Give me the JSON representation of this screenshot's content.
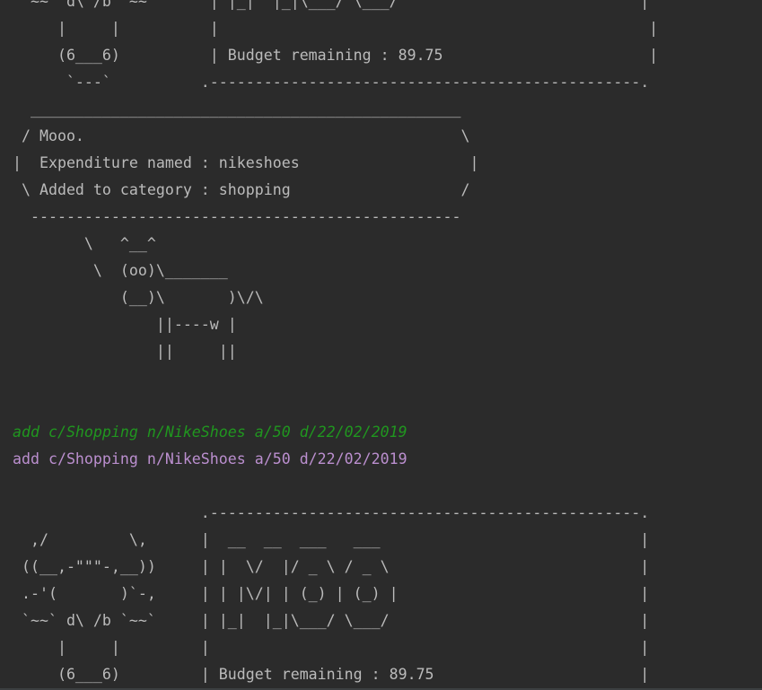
{
  "console": {
    "lines": [
      {
        "kind": "out",
        "text": " `~~` d\\ /b `~~`      | |_|  |_|\\___/ \\___/                           |"
      },
      {
        "kind": "out",
        "text": "     |     |          |                                                |"
      },
      {
        "kind": "out",
        "text": "     (6___6)          | Budget remaining : 89.75                       |"
      },
      {
        "kind": "out",
        "text": "      `---`          .------------------------------------------------."
      },
      {
        "kind": "out",
        "text": "  ________________________________________________"
      },
      {
        "kind": "out",
        "text": " / Mooo.                                          \\"
      },
      {
        "kind": "out",
        "text": "|  Expenditure named : nikeshoes                   |"
      },
      {
        "kind": "out",
        "text": " \\ Added to category : shopping                   /"
      },
      {
        "kind": "out",
        "text": "  ------------------------------------------------"
      },
      {
        "kind": "out",
        "text": "        \\   ^__^"
      },
      {
        "kind": "out",
        "text": "         \\  (oo)\\_______"
      },
      {
        "kind": "out",
        "text": "            (__)\\       )\\/\\"
      },
      {
        "kind": "out",
        "text": "                ||----w |"
      },
      {
        "kind": "out",
        "text": "                ||     ||"
      },
      {
        "kind": "out",
        "text": ""
      },
      {
        "kind": "out",
        "text": ""
      },
      {
        "kind": "echo",
        "text": "add c/Shopping n/NikeShoes a/50 d/22/02/2019"
      },
      {
        "kind": "exec",
        "text": "add c/Shopping n/NikeShoes a/50 d/22/02/2019"
      },
      {
        "kind": "out",
        "text": ""
      },
      {
        "kind": "out",
        "text": "                     .------------------------------------------------."
      },
      {
        "kind": "out",
        "text": "  ,/         \\,      |  __  __  ___   ___                             |"
      },
      {
        "kind": "out",
        "text": " ((__,-\"\"\"-,__))     | |  \\/  |/ _ \\ / _ \\                            |"
      },
      {
        "kind": "out",
        "text": " .-'(       )`-,     | | |\\/| | (_) | (_) |                           |"
      },
      {
        "kind": "out",
        "text": " `~~` d\\ /b `~~`     | |_|  |_|\\___/ \\___/                            |"
      },
      {
        "kind": "out",
        "text": "     |     |         |                                                |"
      },
      {
        "kind": "out",
        "text": "     (6___6)         | Budget remaining : 89.75                       |"
      }
    ]
  }
}
